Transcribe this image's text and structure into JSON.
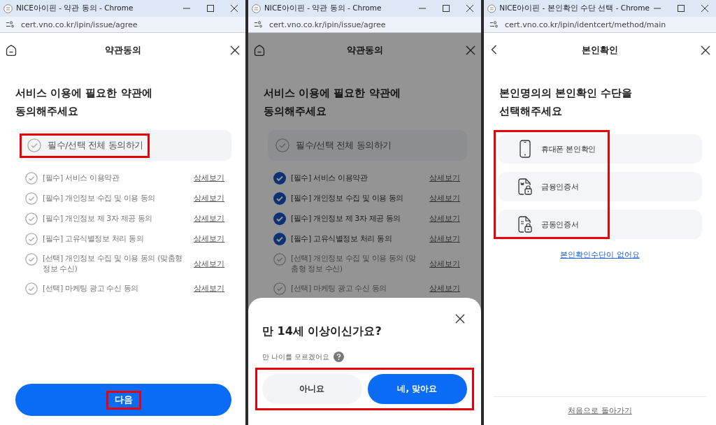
{
  "windows": [
    {
      "kind": "agree",
      "title": "NICE아이핀 - 약관 동의 - Chrome",
      "url": "cert.vno.co.kr/ipin/issue/agree",
      "header": {
        "title": "약관동의"
      },
      "heading": "서비스 이용에 필요한 약관에\n동의해주세요",
      "agree_all": {
        "label": "필수/선택 전체 동의하기",
        "checked": false,
        "highlighted": true
      },
      "terms": [
        {
          "label": "[필수] 서비스 이용약관",
          "checked": false,
          "link": "상세보기"
        },
        {
          "label": "[필수] 개인정보 수집 및 이용 동의",
          "checked": false,
          "link": "상세보기"
        },
        {
          "label": "[필수] 개인정보 제 3자 제공 동의",
          "checked": false,
          "link": "상세보기"
        },
        {
          "label": "[필수] 고유식별정보 처리 동의",
          "checked": false,
          "link": "상세보기"
        },
        {
          "label": "[선택] 개인정보 수집 및 이용 동의 (맞춤형 정보 수신)",
          "checked": false,
          "link": "상세보기"
        },
        {
          "label": "[선택] 마케팅 광고 수신 동의",
          "checked": false,
          "link": "상세보기"
        }
      ],
      "next_button": {
        "label": "다음",
        "highlighted": true
      }
    },
    {
      "kind": "agree",
      "title": "NICE아이핀 - 약관 동의 - Chrome",
      "url": "cert.vno.co.kr/ipin/issue/agree",
      "header": {
        "title": "약관동의"
      },
      "heading": "서비스 이용에 필요한 약관에\n동의해주세요",
      "agree_all": {
        "label": "필수/선택 전체 동의하기",
        "checked": false
      },
      "terms": [
        {
          "label": "[필수] 서비스 이용약관",
          "checked": true,
          "link": "상세보기"
        },
        {
          "label": "[필수] 개인정보 수집 및 이용 동의",
          "checked": true,
          "link": "상세보기"
        },
        {
          "label": "[필수] 개인정보 제 3자 제공 동의",
          "checked": true,
          "link": "상세보기"
        },
        {
          "label": "[필수] 고유식별정보 처리 동의",
          "checked": true,
          "link": "상세보기"
        },
        {
          "label": "[선택] 개인정보 수집 및 이용 동의 (맞춤형 정보 수신)",
          "checked": false,
          "link": "상세보기"
        },
        {
          "label": "[선택] 마케팅 광고 수신 동의",
          "checked": false,
          "link": "상세보기"
        }
      ],
      "modal": {
        "title": "만 14세 이상이신가요?",
        "help": "만 나이를 모르겠어요",
        "highlighted": true,
        "buttons": [
          {
            "label": "아니요",
            "kind": "secondary"
          },
          {
            "label": "네, 맞아요",
            "kind": "primary"
          }
        ]
      }
    },
    {
      "kind": "method",
      "title": "NICE아이핀 - 본인확인 수단 선택 - Chrome",
      "url": "cert.vno.co.kr/ipin/identcert/method/main",
      "header": {
        "title": "본인확인"
      },
      "heading": "본인명의의 본인확인 수단을\n선택해주세요",
      "methods": [
        {
          "label": "휴대폰 본인확인",
          "kind": "phone"
        },
        {
          "label": "금융인증서",
          "kind": "bank"
        },
        {
          "label": "공동인증서",
          "kind": "joint"
        }
      ],
      "methods_highlighted": true,
      "link": "본인확인수단이 없어요",
      "footer_link": "처음으로 돌아가기"
    }
  ]
}
